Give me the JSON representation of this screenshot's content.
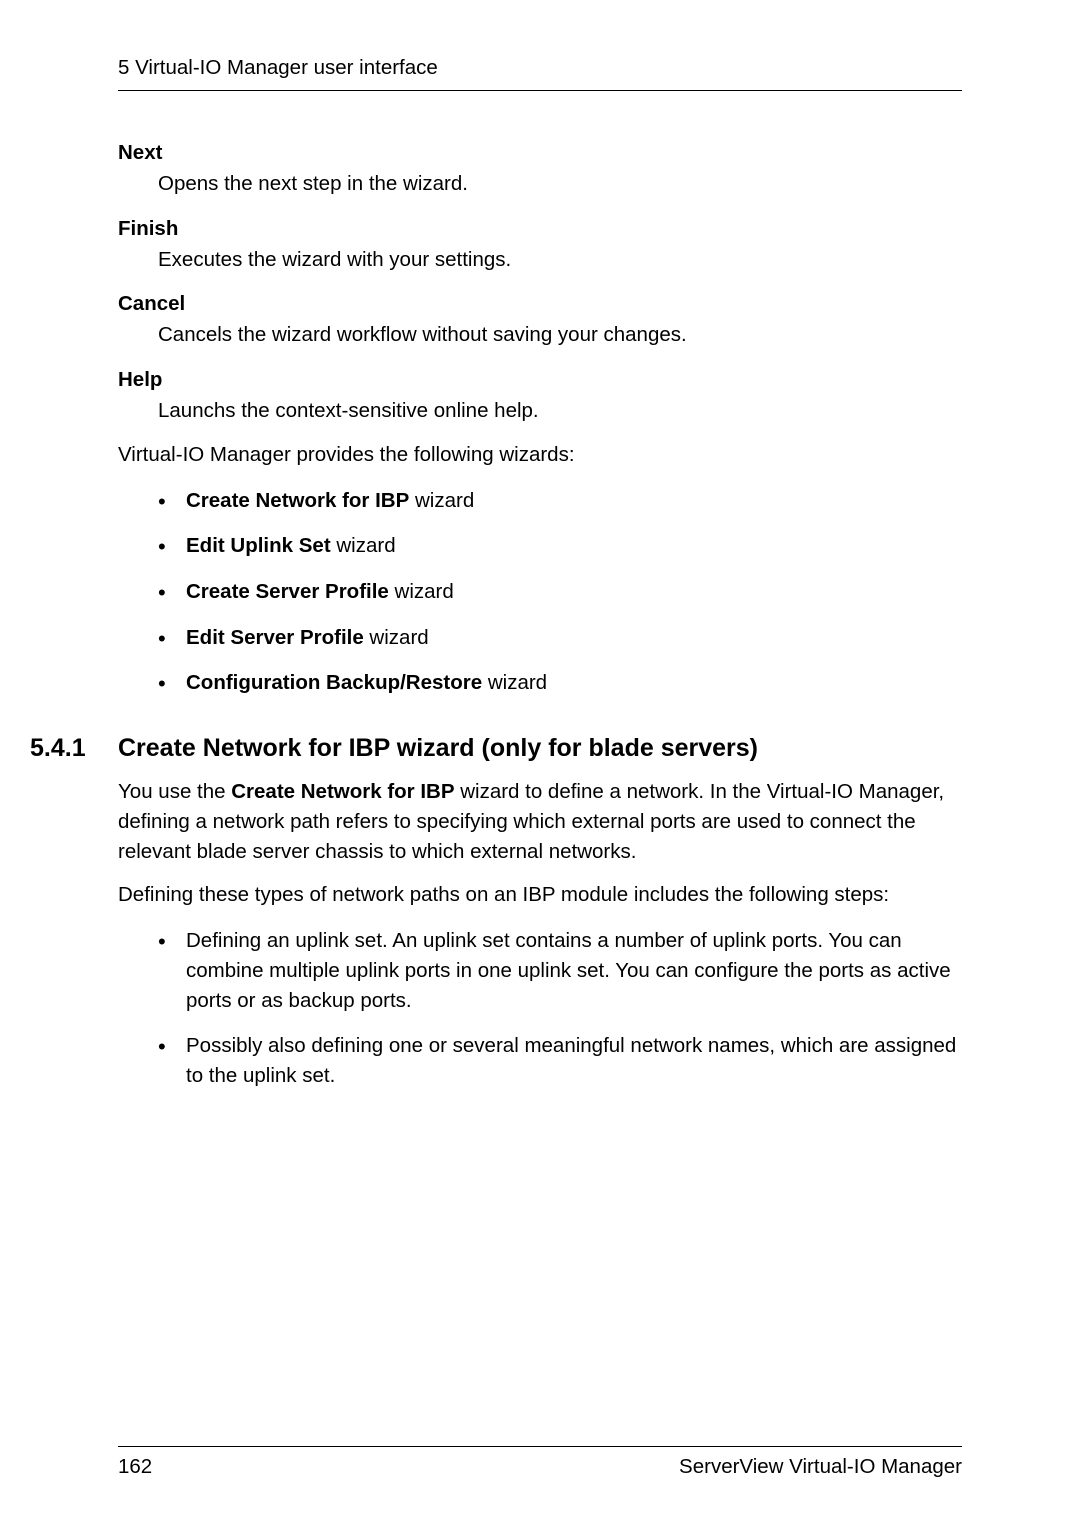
{
  "header": "5 Virtual-IO Manager user interface",
  "defs": [
    {
      "term": "Next",
      "desc": "Opens the next step in the wizard."
    },
    {
      "term": "Finish",
      "desc": "Executes the wizard with your settings."
    },
    {
      "term": "Cancel",
      "desc": "Cancels the wizard workflow without saving your changes."
    },
    {
      "term": "Help",
      "desc": "Launchs the context-sensitive online help."
    }
  ],
  "wizard_intro": "Virtual-IO Manager provides the following wizards:",
  "wizard_list": [
    {
      "bold": "Create Network for IBP",
      "rest": " wizard"
    },
    {
      "bold": "Edit Uplink Set",
      "rest": " wizard"
    },
    {
      "bold": "Create Server Profile",
      "rest": " wizard"
    },
    {
      "bold": "Edit Server Profile",
      "rest": " wizard"
    },
    {
      "bold": "Configuration Backup/Restore",
      "rest": " wizard"
    }
  ],
  "section": {
    "num": "5.4.1",
    "title": "Create Network for IBP wizard (only for blade servers)"
  },
  "body": {
    "p1_prefix": "You use the ",
    "p1_bold": "Create Network for IBP",
    "p1_suffix": " wizard to define a network. In the Virtual-IO Manager, defining a network path refers to specifying which external ports are used to connect the relevant blade server chassis to which external networks.",
    "p2": "Defining these types of network paths on an IBP module includes the following steps:",
    "steps": [
      "Defining an uplink set. An uplink set contains a number of uplink ports. You can combine multiple uplink ports in one uplink set. You can configure the ports as active ports or as backup ports.",
      "Possibly also defining one or several meaningful network names, which are assigned to the uplink set."
    ]
  },
  "footer": {
    "page": "162",
    "doc": "ServerView Virtual-IO Manager"
  }
}
